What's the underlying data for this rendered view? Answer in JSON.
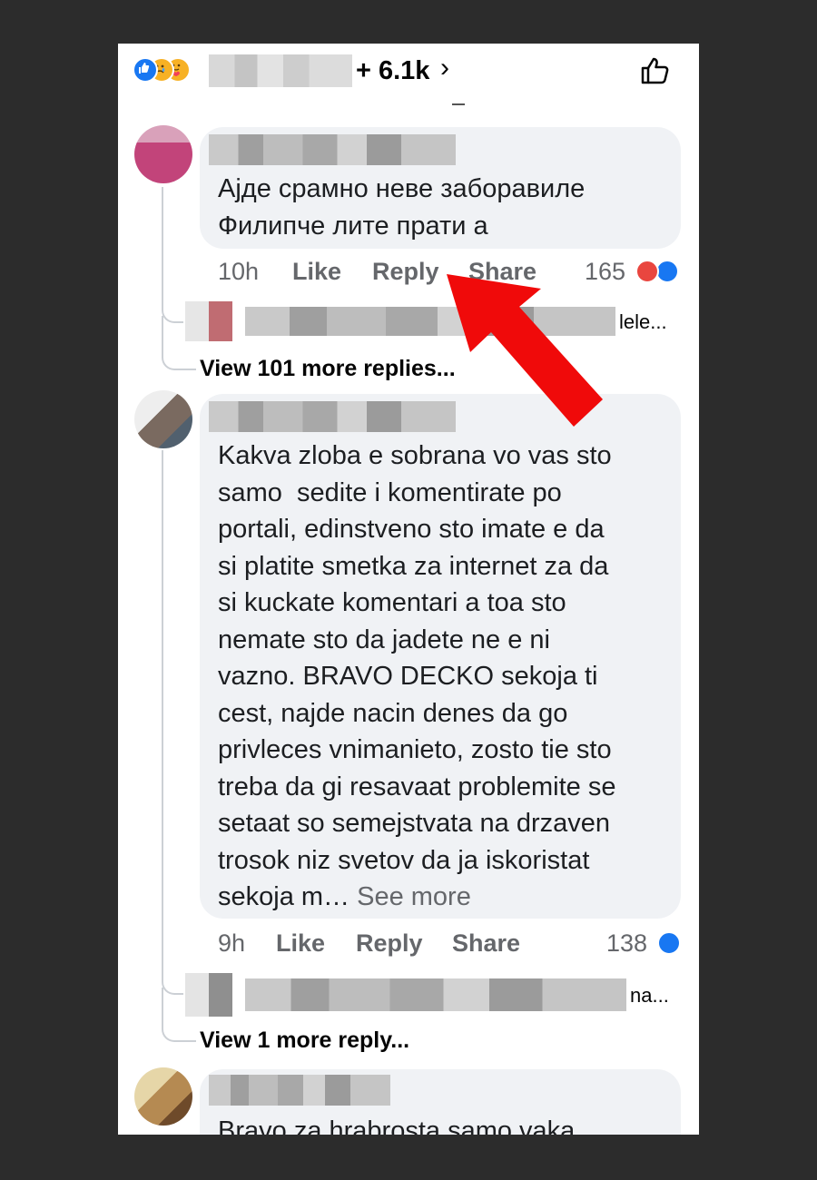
{
  "header": {
    "reaction_icons": [
      "like-icon",
      "sad-icon",
      "care-icon"
    ],
    "reaction_count": "+ 6.1k",
    "chevron": "›",
    "like_button_icon": "thumbs-up-outline-icon"
  },
  "comments": [
    {
      "text": "Ајде срамно неве заборавиле\nФилипче лите прати а",
      "time": "10h",
      "like_label": "Like",
      "reply_label": "Reply",
      "share_label": "Share",
      "reaction_count": "165",
      "reaction_icons": [
        "angry-icon",
        "like-icon"
      ],
      "reply_preview_suffix": "lele...",
      "view_more_label": "View 101 more replies..."
    },
    {
      "text": "Kakva zloba e sobrana vo vas sto\nsamo  sedite i komentirate po\nportali, edinstveno sto imate e da\nsi platite smetka za internet za da\nsi kuckate komentari a toa sto\nnemate sto da jadete ne e ni\nvazno. BRAVO DECKO sekoja ti\ncest, najde nacin denes da go\nprivleces vnimanieto, zosto tie sto\ntreba da gi resavaat problemite se\nsetaat so semejstvata na drzaven\ntrosok niz svetov da ja iskoristat\nsekoja m… ",
      "see_more": "See more",
      "time": "9h",
      "like_label": "Like",
      "reply_label": "Reply",
      "share_label": "Share",
      "reaction_count": "138",
      "reaction_icons": [
        "like-icon"
      ],
      "reply_preview_suffix": "na...",
      "view_more_label": "View 1 more reply..."
    },
    {
      "text": "Bravo za hrabrosta samo vaka"
    }
  ],
  "annotation": {
    "arrow_color": "#f00a0a",
    "arrow_icon": "red-arrow-pointer"
  },
  "colors": {
    "background": "#2c2c2c",
    "bubble": "#f0f2f5",
    "like_blue": "#1877f2",
    "angry_red": "#e9463f",
    "secondary_text": "#65676b"
  }
}
